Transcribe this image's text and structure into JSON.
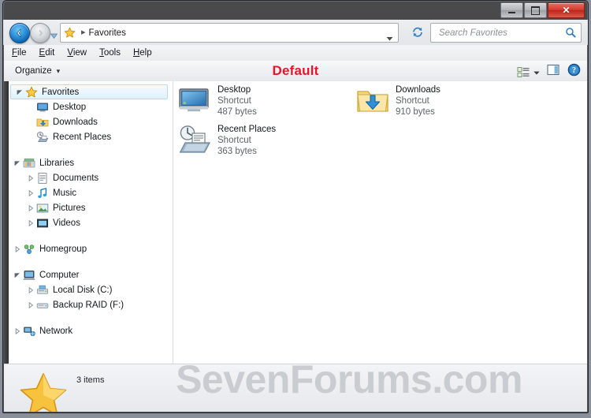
{
  "window": {
    "minimize_label": "Minimize",
    "maximize_label": "Maximize",
    "close_label": "✕"
  },
  "address": {
    "back_label": "Back",
    "forward_label": "Forward",
    "breadcrumb_icon": "star-icon",
    "breadcrumb_separator": "▸",
    "breadcrumb_text": "Favorites",
    "refresh_label": "Refresh"
  },
  "search": {
    "placeholder": "Search Favorites",
    "value": ""
  },
  "menu": {
    "items": [
      {
        "accel": "F",
        "rest": "ile"
      },
      {
        "accel": "E",
        "rest": "dit"
      },
      {
        "accel": "V",
        "rest": "iew"
      },
      {
        "accel": "T",
        "rest": "ools"
      },
      {
        "accel": "H",
        "rest": "elp"
      }
    ]
  },
  "toolbar": {
    "organize_label": "Organize",
    "organize_caret": "▾",
    "annotation": "Default",
    "views_label": "Change your view",
    "preview_label": "Show the preview pane",
    "help_label": "Get help"
  },
  "navpane": {
    "groups": [
      {
        "items": [
          {
            "label": "Favorites",
            "icon": "star-icon",
            "expander": "expanded",
            "indent": 0,
            "selected": true
          },
          {
            "label": "Desktop",
            "icon": "desktop-icon",
            "expander": "none",
            "indent": 1,
            "selected": false
          },
          {
            "label": "Downloads",
            "icon": "downloads-folder-icon",
            "expander": "none",
            "indent": 1,
            "selected": false
          },
          {
            "label": "Recent Places",
            "icon": "recent-places-icon",
            "expander": "none",
            "indent": 1,
            "selected": false
          }
        ]
      },
      {
        "items": [
          {
            "label": "Libraries",
            "icon": "libraries-icon",
            "expander": "expanded",
            "indent": 0,
            "selected": false
          },
          {
            "label": "Documents",
            "icon": "documents-library-icon",
            "expander": "collapsed",
            "indent": 1,
            "selected": false
          },
          {
            "label": "Music",
            "icon": "music-library-icon",
            "expander": "collapsed",
            "indent": 1,
            "selected": false
          },
          {
            "label": "Pictures",
            "icon": "pictures-library-icon",
            "expander": "collapsed",
            "indent": 1,
            "selected": false
          },
          {
            "label": "Videos",
            "icon": "videos-library-icon",
            "expander": "collapsed",
            "indent": 1,
            "selected": false
          }
        ]
      },
      {
        "items": [
          {
            "label": "Homegroup",
            "icon": "homegroup-icon",
            "expander": "collapsed",
            "indent": 0,
            "selected": false
          }
        ]
      },
      {
        "items": [
          {
            "label": "Computer",
            "icon": "computer-icon",
            "expander": "expanded",
            "indent": 0,
            "selected": false
          },
          {
            "label": "Local Disk (C:)",
            "icon": "system-drive-icon",
            "expander": "collapsed",
            "indent": 1,
            "selected": false
          },
          {
            "label": "Backup RAID (F:)",
            "icon": "drive-icon",
            "expander": "collapsed",
            "indent": 1,
            "selected": false
          }
        ]
      },
      {
        "items": [
          {
            "label": "Network",
            "icon": "network-icon",
            "expander": "collapsed",
            "indent": 0,
            "selected": false
          }
        ]
      }
    ]
  },
  "files": [
    {
      "name": "Desktop",
      "type": "Shortcut",
      "size": "487 bytes",
      "icon": "desktop-shortcut-icon",
      "col": 0,
      "row": 0
    },
    {
      "name": "Downloads",
      "type": "Shortcut",
      "size": "910 bytes",
      "icon": "downloads-shortcut-icon",
      "col": 1,
      "row": 0
    },
    {
      "name": "Recent Places",
      "type": "Shortcut",
      "size": "363 bytes",
      "icon": "recent-places-shortcut-icon",
      "col": 0,
      "row": 1
    }
  ],
  "status": {
    "item_count": "3 items",
    "icon": "star-icon"
  },
  "watermark": {
    "text": "SevenForums.com"
  },
  "colors": {
    "annotation_red": "#e8142a",
    "selection_blue": "#b9d9ef",
    "titlebar_dark": "#3e3e40",
    "watermark_gray": "#c9cdd1"
  }
}
